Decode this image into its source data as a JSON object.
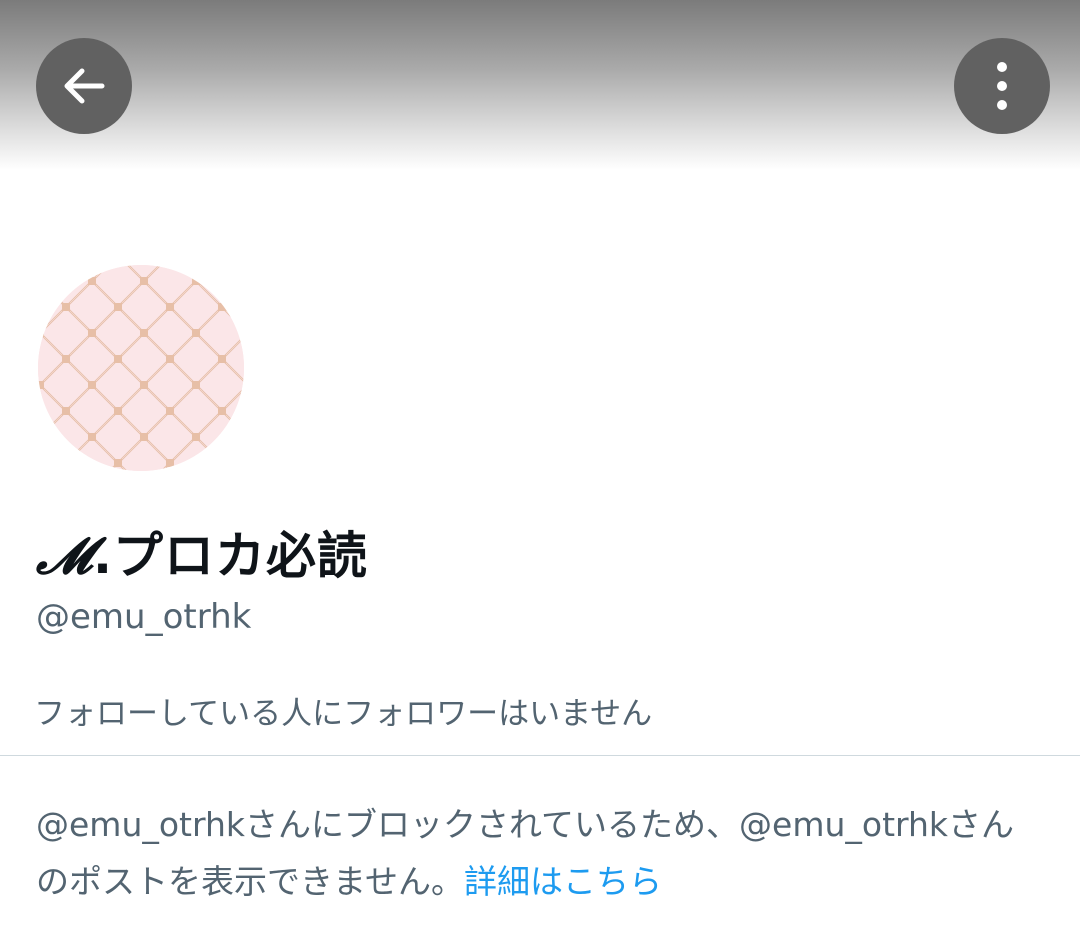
{
  "header": {
    "back_icon": "arrow-left-icon",
    "more_icon": "vertical-ellipsis-icon",
    "button_color": "#616161"
  },
  "profile": {
    "avatar": "avatar-pink-lattice-pattern",
    "display_name_script": "𝓜",
    "display_name_rest": ".プロカ必読",
    "handle": "@emu_otrhk",
    "follow_note": "フォローしている人にフォロワーはいません"
  },
  "blocked": {
    "message": "@emu_otrhkさんにブロックされているため、@emu_otrhkさんのポストを表示できません。",
    "link_label": "詳細はこちら",
    "link_color": "#1d9bf0"
  }
}
